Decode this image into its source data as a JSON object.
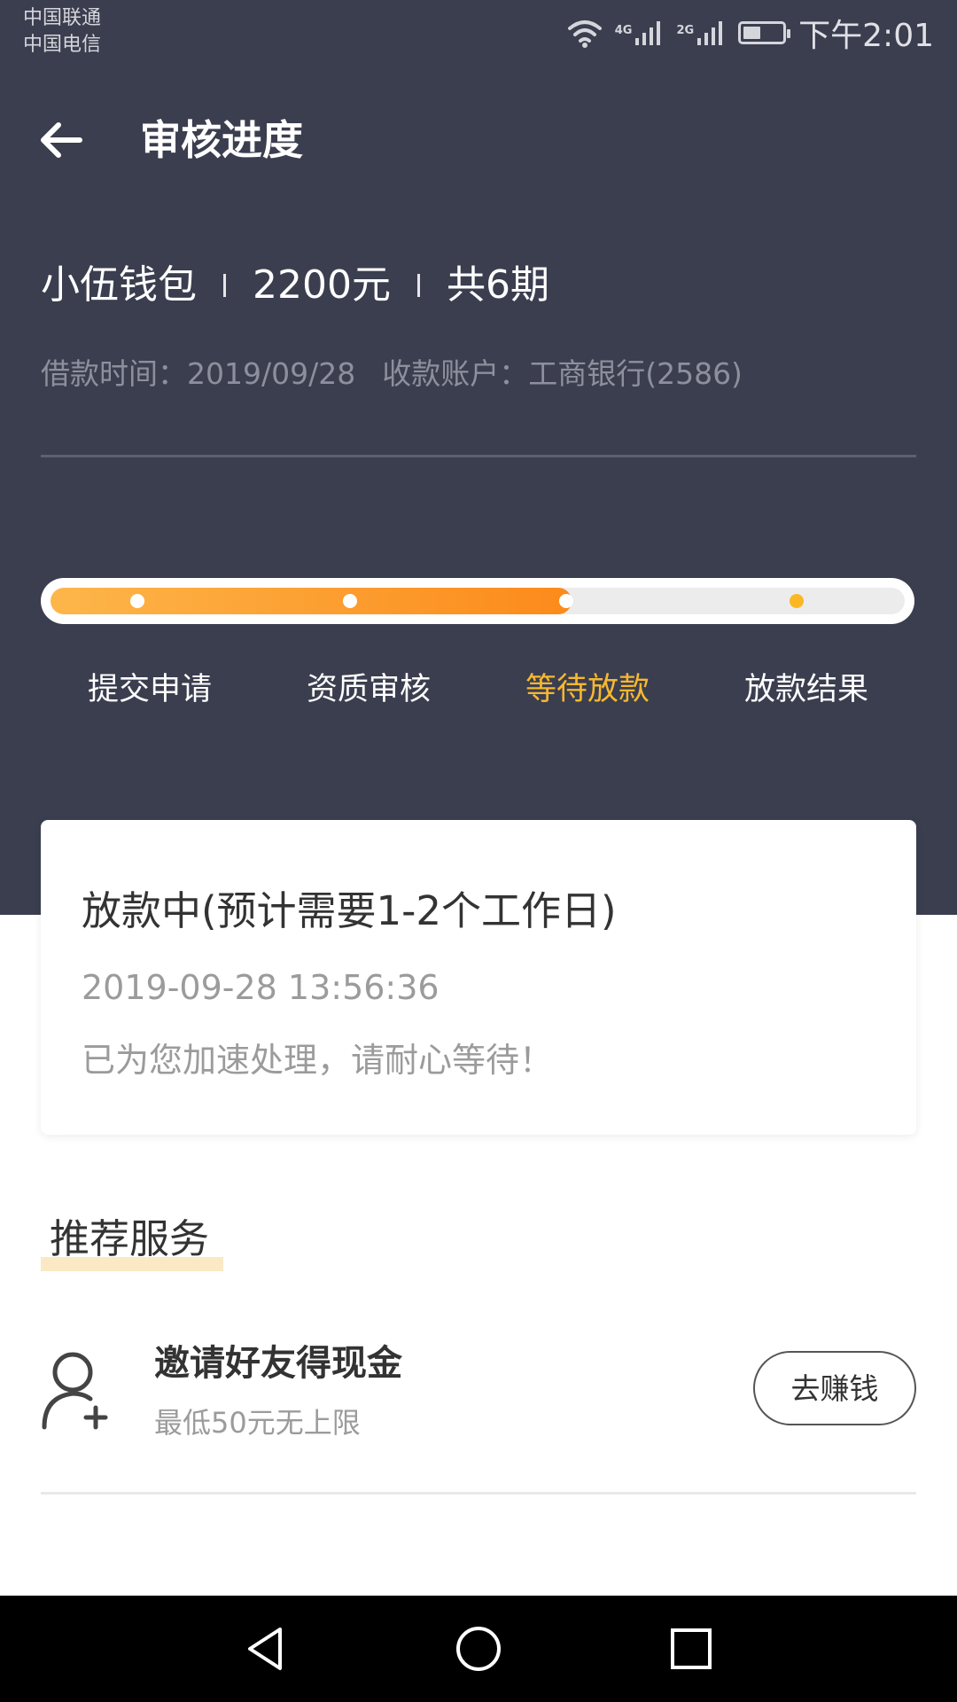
{
  "status_bar": {
    "carrier_1": "中国联通",
    "carrier_2": "中国电信",
    "net_1": "4G",
    "net_2": "2G",
    "battery_level": 0.45,
    "time": "下午2:01"
  },
  "header": {
    "title": "审核进度",
    "back_icon": "arrow-left-icon"
  },
  "loan": {
    "product": "小伍钱包",
    "amount": "2200元",
    "installments": "共6期",
    "borrow_time": "借款时间：2019/09/28",
    "account": "收款账户：工商银行(2586)"
  },
  "progress": {
    "fill_fraction": 0.61,
    "current_step": 2,
    "steps": [
      {
        "label": "提交申请",
        "status": "done"
      },
      {
        "label": "资质审核",
        "status": "done"
      },
      {
        "label": "等待放款",
        "status": "active"
      },
      {
        "label": "放款结果",
        "status": "pending"
      }
    ],
    "colors": {
      "fill_start": "#fdb64a",
      "fill_end": "#fc8a1b",
      "active_label": "#f6b830",
      "pending_dot": "#fbb824"
    }
  },
  "status_card": {
    "title": "放款中(预计需要1-2个工作日)",
    "timestamp": "2019-09-28 13:56:36",
    "message": "已为您加速处理，请耐心等待！"
  },
  "recommend": {
    "section_title": "推荐服务",
    "items": [
      {
        "icon": "user-add-icon",
        "title": "邀请好友得现金",
        "subtitle": "最低50元无上限",
        "button_label": "去赚钱"
      }
    ]
  },
  "nav_bar": {
    "icons": [
      "back-triangle-icon",
      "home-circle-icon",
      "recents-square-icon"
    ]
  }
}
